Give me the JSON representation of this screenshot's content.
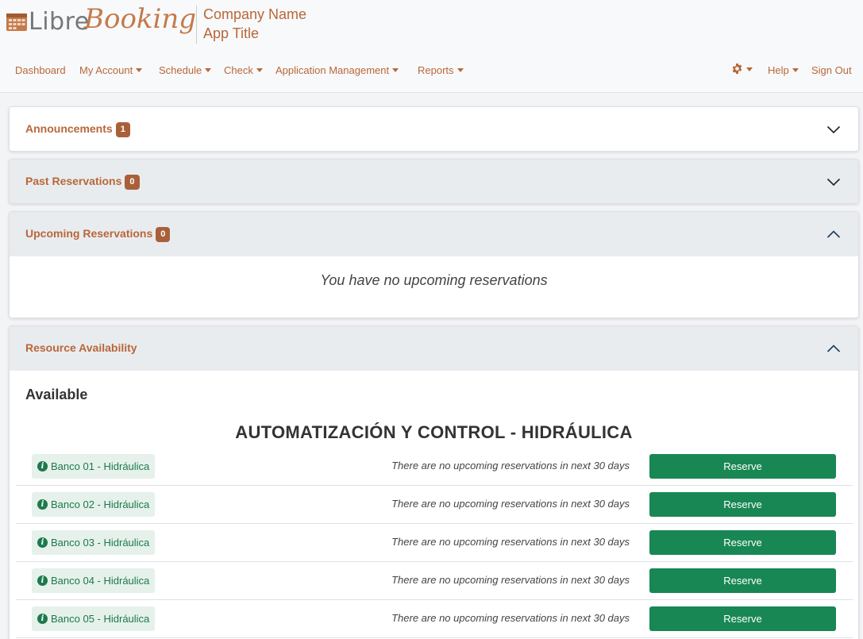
{
  "header": {
    "logo_libre": "Libre",
    "logo_booking": "Booking",
    "company_name": "Company Name",
    "app_title": "App Title"
  },
  "nav": {
    "left": [
      {
        "label": "Dashboard",
        "dropdown": false
      },
      {
        "label": "My Account",
        "dropdown": true
      },
      {
        "label": "Schedule",
        "dropdown": true
      },
      {
        "label": "Check",
        "dropdown": true
      },
      {
        "label": "Application Management",
        "dropdown": true
      },
      {
        "label": "Reports",
        "dropdown": true
      }
    ],
    "settings_icon": "gear-icon",
    "help": "Help",
    "sign_out": "Sign Out"
  },
  "announcements": {
    "title": "Announcements",
    "count": "1",
    "expanded": false
  },
  "past_reservations": {
    "title": "Past Reservations",
    "count": "0",
    "expanded": false
  },
  "upcoming_reservations": {
    "title": "Upcoming Reservations",
    "count": "0",
    "expanded": true,
    "empty_message": "You have no upcoming reservations"
  },
  "resource_availability": {
    "title": "Resource Availability",
    "expanded": true,
    "available_heading": "Available",
    "schedule_name": "AUTOMATIZACIÓN Y CONTROL - HIDRÁULICA",
    "reserve_label": "Reserve",
    "resources": [
      {
        "name": "Banco 01 - Hidráulica",
        "note": "There are no upcoming reservations in next 30 days"
      },
      {
        "name": "Banco 02 - Hidráulica",
        "note": "There are no upcoming reservations in next 30 days"
      },
      {
        "name": "Banco 03 - Hidráulica",
        "note": "There are no upcoming reservations in next 30 days"
      },
      {
        "name": "Banco 04 - Hidráulica",
        "note": "There are no upcoming reservations in next 30 days"
      },
      {
        "name": "Banco 05 - Hidráulica",
        "note": "There are no upcoming reservations in next 30 days"
      }
    ]
  },
  "colors": {
    "accent": "#b8673a",
    "badge": "#a9603a",
    "reserve": "#198754",
    "resource_text": "#1b7a4c"
  }
}
